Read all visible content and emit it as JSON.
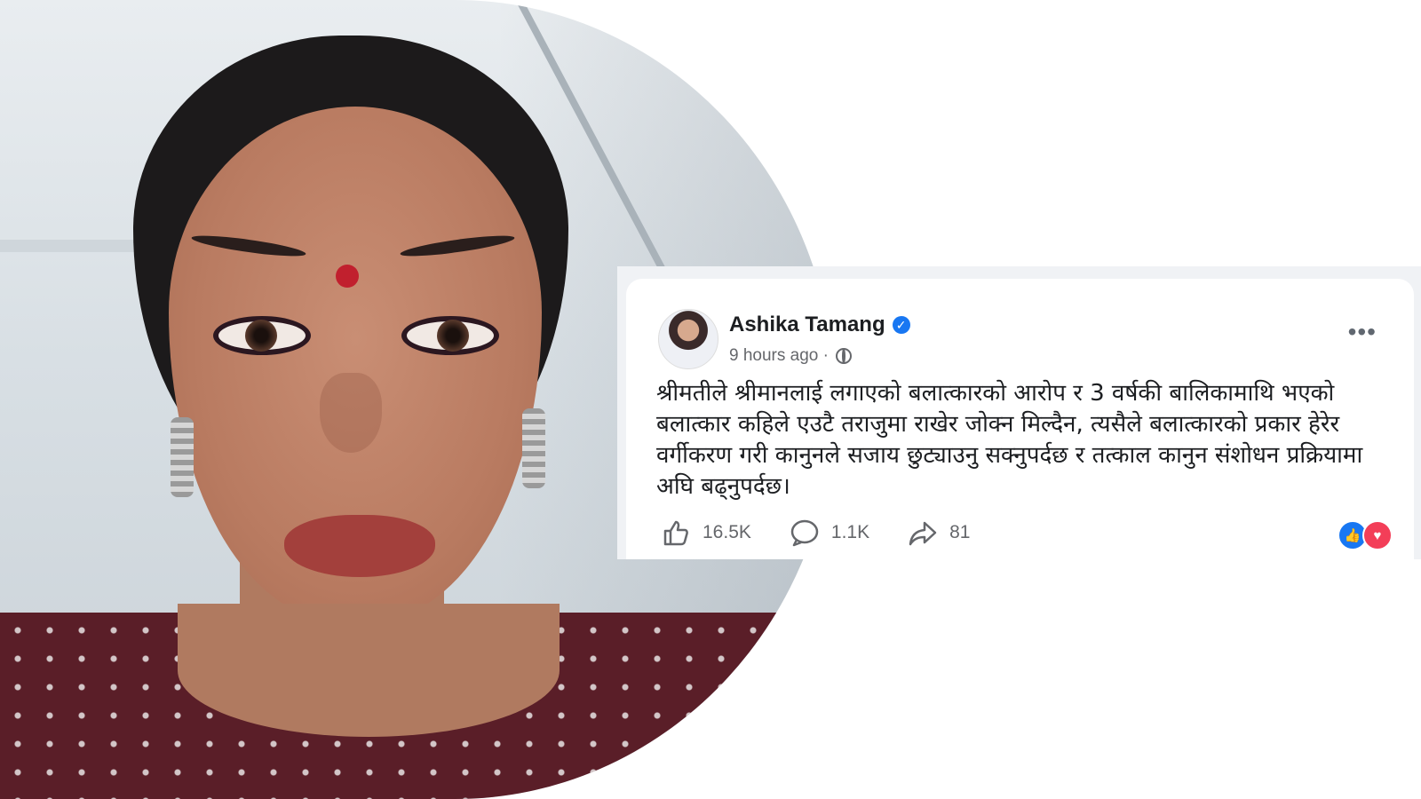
{
  "post": {
    "author": "Ashika Tamang",
    "verified_icon": "verified-badge-icon",
    "time": "9 hours ago ·",
    "privacy_icon": "globe-icon",
    "more_label": "•••",
    "text": "श्रीमतीले श्रीमानलाई लगाएको बलात्कारको आरोप र 3 वर्षकी बालिकामाथि भएको बलात्कार कहिले एउटै तराजुमा राखेर जोक्न मिल्दैन, त्यसैले बलात्कारको प्रकार हेरेर वर्गीकरण गरी कानुनले सजाय छुट्याउनु सक्नुपर्दछ र तत्काल कानुन संशोधन प्रक्रियामा अघि बढ्नुपर्दछ।",
    "likes": "16.5K",
    "comments": "1.1K",
    "shares": "81"
  },
  "colors": {
    "facebook_blue": "#1877f2",
    "love_red": "#f33e58",
    "text_dark": "#1c1e21",
    "text_muted": "#65676b"
  }
}
